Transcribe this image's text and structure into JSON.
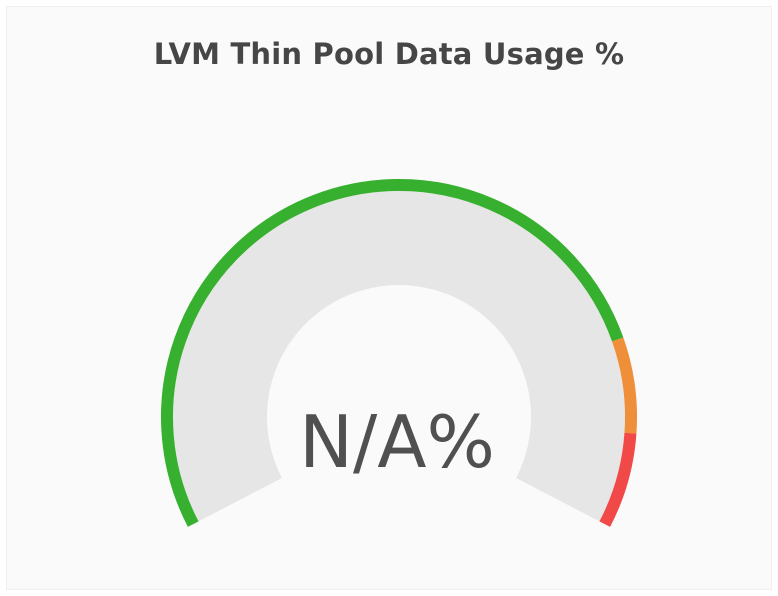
{
  "panel": {
    "title": "LVM Thin Pool Data Usage %"
  },
  "gauge": {
    "value_text": "N/A%",
    "min": 0,
    "max": 100,
    "thresholds": [
      {
        "from": 0,
        "to": 80,
        "color": "#37b02f"
      },
      {
        "from": 80,
        "to": 90,
        "color": "#ef8f3a"
      },
      {
        "from": 90,
        "to": 100,
        "color": "#f14848"
      }
    ],
    "track_color": "#e6e6e6",
    "value_color": "#505050"
  }
}
